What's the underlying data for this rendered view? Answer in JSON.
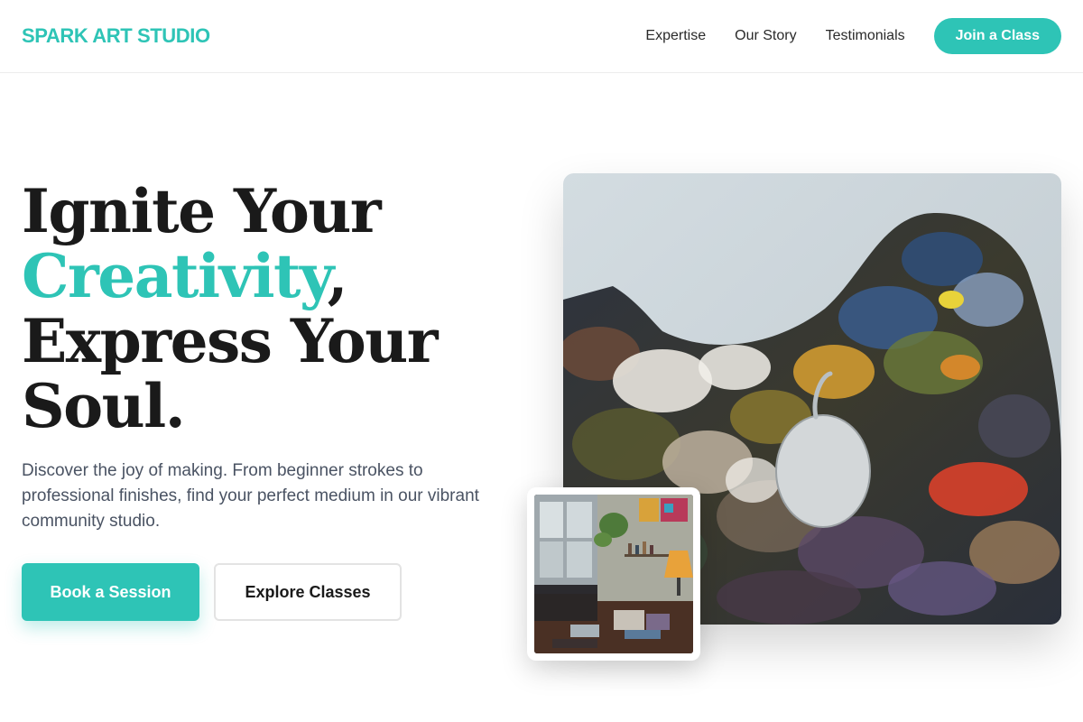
{
  "brand": {
    "name": "SPARK ART STUDIO",
    "accent_color": "#2ec4b6"
  },
  "nav": {
    "links": [
      "Expertise",
      "Our Story",
      "Testimonials"
    ],
    "cta_label": "Join a Class"
  },
  "hero": {
    "title_line1": "Ignite Your",
    "title_accent": "Creativity",
    "title_accent_suffix": ",",
    "title_line3": "Express Your",
    "title_line4": "Soul.",
    "description": "Discover the joy of making. From beginner strokes to professional finishes, find your perfect medium in our vibrant community studio.",
    "primary_button": "Book a Session",
    "secondary_button": "Explore Classes"
  },
  "images": {
    "main": "paint-palette-photo",
    "thumbnail": "art-studio-interior-photo"
  }
}
